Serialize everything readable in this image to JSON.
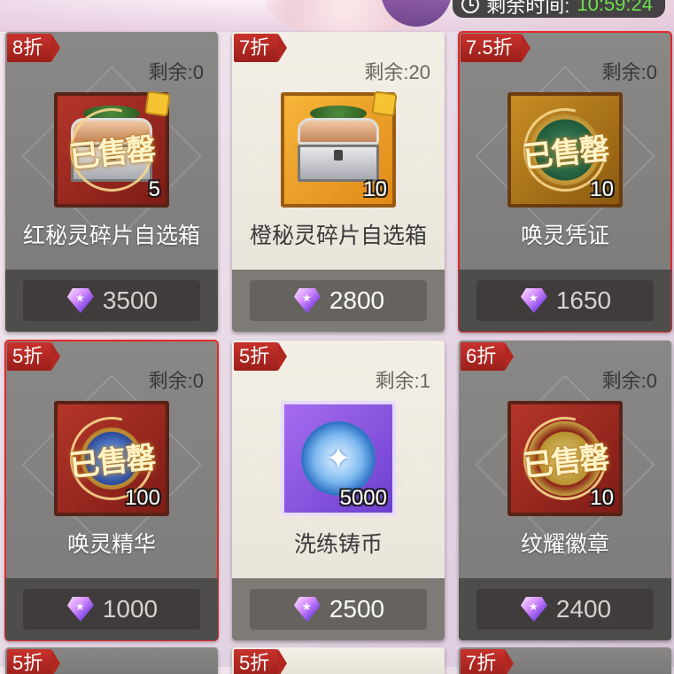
{
  "timer": {
    "label": "剩余时间:",
    "value": "10:59:24"
  },
  "remain_label": "剩余:",
  "items": [
    {
      "discount": "8折",
      "remaining": "0",
      "name": "红秘灵碎片自选箱",
      "count": "5",
      "price": "3500",
      "sold_out": true,
      "sold_label": "已售罄",
      "theme": "dark",
      "frame": "red",
      "art": "chest",
      "selected": false
    },
    {
      "discount": "7折",
      "remaining": "20",
      "name": "橙秘灵碎片自选箱",
      "count": "10",
      "price": "2800",
      "sold_out": false,
      "theme": "light",
      "frame": "orange",
      "art": "chest",
      "selected": false
    },
    {
      "discount": "7.5折",
      "remaining": "0",
      "name": "唤灵凭证",
      "count": "10",
      "price": "1650",
      "sold_out": true,
      "sold_label": "已售罄",
      "theme": "dark",
      "frame": "gold",
      "art": "token",
      "selected": true
    },
    {
      "discount": "5折",
      "remaining": "0",
      "name": "唤灵精华",
      "count": "100",
      "price": "1000",
      "sold_out": true,
      "sold_label": "已售罄",
      "theme": "dark",
      "frame": "red",
      "art": "gem-core",
      "selected": true
    },
    {
      "discount": "5折",
      "remaining": "1",
      "name": "洗练铸币",
      "count": "5000",
      "price": "2500",
      "sold_out": false,
      "theme": "light",
      "frame": "purple",
      "art": "medal",
      "selected": false
    },
    {
      "discount": "6折",
      "remaining": "0",
      "name": "纹耀徽章",
      "count": "10",
      "price": "2400",
      "sold_out": true,
      "sold_label": "已售罄",
      "theme": "dark",
      "frame": "red",
      "art": "badge-gear",
      "selected": false
    }
  ],
  "peek_discounts": [
    "5折",
    "5折",
    "7折"
  ]
}
